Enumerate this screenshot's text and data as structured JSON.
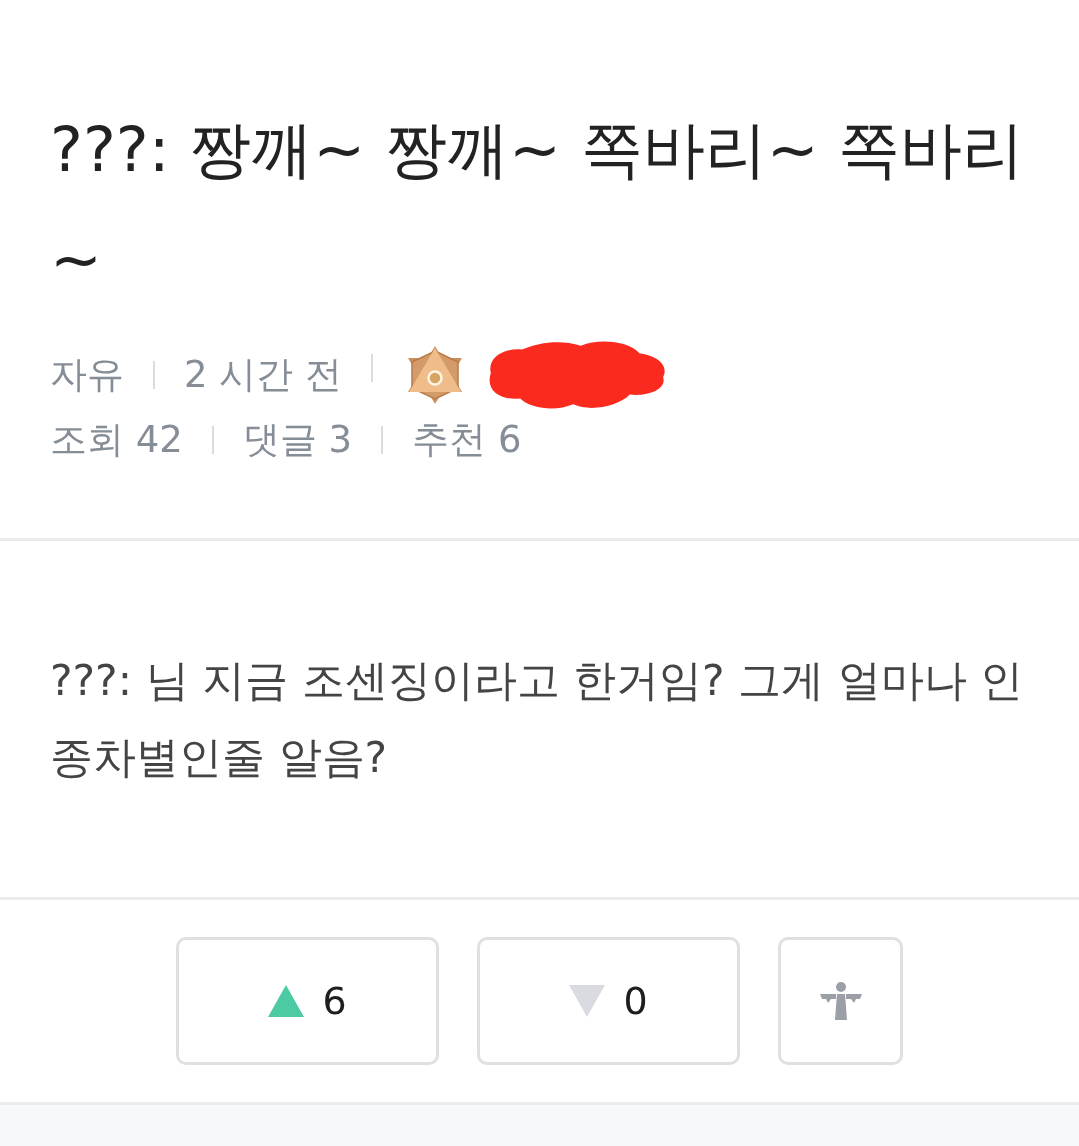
{
  "post": {
    "title": "???: 짱깨~ 짱깨~ 쪽바리~ 쪽바리~",
    "category": "자유",
    "time": "2 시간 전",
    "author": {
      "redacted": true
    },
    "stats": [
      "조회 42",
      "댓글 3",
      "추천 6"
    ],
    "body": "???: 님 지금 조센징이라고 한거임? 그게 얼마나 인종차별인줄 알음?"
  },
  "votes": [
    {
      "kind": "up",
      "count": "6"
    },
    {
      "kind": "down",
      "count": "0"
    }
  ]
}
